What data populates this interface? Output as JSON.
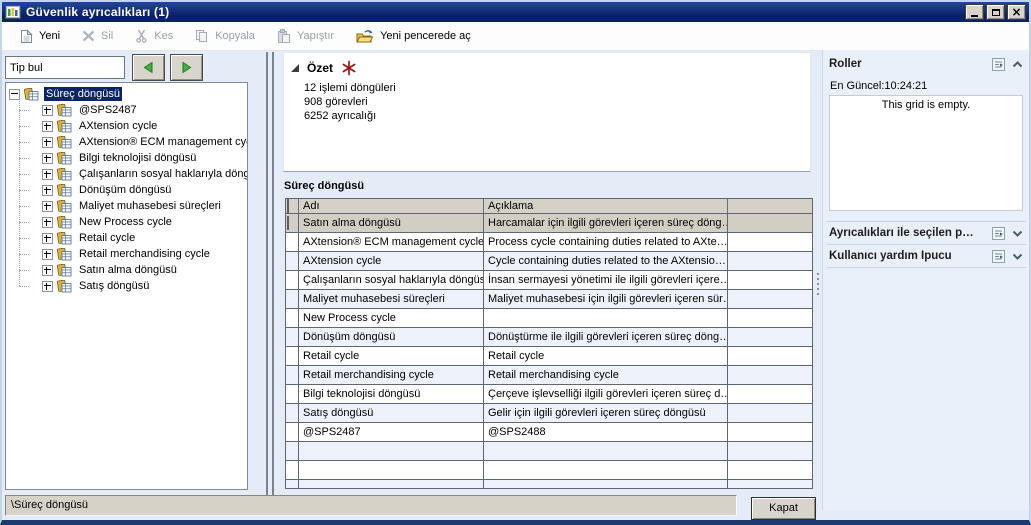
{
  "window": {
    "title": "Güvenlik ayrıcalıkları (1)"
  },
  "toolbar": {
    "items": [
      {
        "label": "Yeni",
        "enabled": true
      },
      {
        "label": "Sil",
        "enabled": false
      },
      {
        "label": "Kes",
        "enabled": false
      },
      {
        "label": "Kopyala",
        "enabled": false
      },
      {
        "label": "Yapıştır",
        "enabled": false
      },
      {
        "label": "Yeni pencerede aç",
        "enabled": true
      }
    ]
  },
  "left_panel": {
    "filter_value": "Tip bul",
    "tree": {
      "root": "Süreç döngüsü",
      "children": [
        "@SPS2487",
        "AXtension cycle",
        "AXtension® ECM management cycle",
        "Bilgi teknolojisi döngüsü",
        "Çalışanların sosyal haklarıyla döngüsü",
        "Dönüşüm döngüsü",
        "Maliyet muhasebesi süreçleri",
        "New Process cycle",
        "Retail cycle",
        "Retail merchandising cycle",
        "Satın alma döngüsü",
        "Satış döngüsü"
      ]
    }
  },
  "summary": {
    "title": "Özet",
    "lines": [
      "12 işlemi döngüleri",
      "908 görevleri",
      "6252 ayrıcalığı"
    ]
  },
  "grid": {
    "section_title": "Süreç döngüsü",
    "columns": [
      "Adı",
      "Açıklama"
    ],
    "rows": [
      {
        "name": "Satın alma döngüsü",
        "description": "Harcamalar için ilgili görevleri içeren süreç döng…",
        "selected": true
      },
      {
        "name": "AXtension® ECM management cycle",
        "description": "Process cycle containing duties related to AXte…",
        "selected": false
      },
      {
        "name": "AXtension cycle",
        "description": "Cycle containing duties related to the AXtensio…",
        "selected": false
      },
      {
        "name": "Çalışanların sosyal haklarıyla döngüsü",
        "description": "İnsan sermayesi yönetimi ile ilgili görevleri içere…",
        "selected": false
      },
      {
        "name": "Maliyet muhasebesi süreçleri",
        "description": "Maliyet muhasebesi için ilgili görevleri içeren sür…",
        "selected": false
      },
      {
        "name": "New Process cycle",
        "description": "",
        "selected": false
      },
      {
        "name": "Dönüşüm döngüsü",
        "description": "Dönüştürme ile ilgili görevleri içeren süreç döng…",
        "selected": false
      },
      {
        "name": "Retail cycle",
        "description": "Retail cycle",
        "selected": false
      },
      {
        "name": "Retail merchandising cycle",
        "description": "Retail merchandising cycle",
        "selected": false
      },
      {
        "name": "Bilgi teknolojisi döngüsü",
        "description": "Çerçeve işlevselliği ilgili görevleri içeren süreç d…",
        "selected": false
      },
      {
        "name": "Satış döngüsü",
        "description": "Gelir için ilgili görevleri içeren süreç döngüsü",
        "selected": false
      },
      {
        "name": "@SPS2487",
        "description": "@SPS2488",
        "selected": false
      }
    ]
  },
  "right_panel": {
    "sections": [
      {
        "title": "Roller",
        "expanded": true,
        "status": "En Güncel:10:24:21",
        "empty_text": "This grid is empty."
      },
      {
        "title": "Ayrıcalıkları ile seçilen p…",
        "expanded": false
      },
      {
        "title": "Kullanıcı yardım İpucu",
        "expanded": false
      }
    ]
  },
  "status_bar": {
    "path": "\\Süreç döngüsü",
    "close_label": "Kapat"
  },
  "icons": {
    "app": "ax-window-bars",
    "new": "blank-page",
    "delete": "gray-x",
    "cut": "scissors",
    "copy": "double-page",
    "paste": "clipboard",
    "open_new_window": "open-folder-arrow",
    "nav_prev": "green-left-triangle",
    "nav_next": "green-right-triangle",
    "tree_node": "process-cycle-book-grid",
    "summary_expander": "filled-corner-triangle",
    "required": "red-asterisk",
    "fact_open": "grid-with-arrow",
    "collapse": "chevron-up",
    "expand": "chevron-down",
    "minimize": "underscore",
    "maximize": "square",
    "close": "x"
  },
  "colors": {
    "titlebar": "#0a2166",
    "selection": "#0a246a",
    "grid_header": "#d5d1c6",
    "selected_row": "#d2cec3",
    "alt_row": "#eef2fb",
    "asterisk": "#a01212",
    "nav_arrow_green": "#44b044",
    "window_bg": "#e4ecf8"
  }
}
